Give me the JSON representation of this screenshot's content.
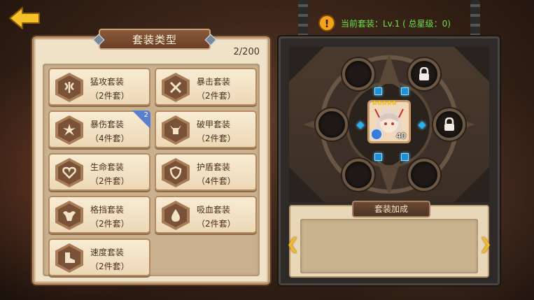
{
  "panel": {
    "title": "套装类型",
    "count": "2/200"
  },
  "sets": [
    {
      "name": "猛攻套装",
      "pieces": "（2件套）",
      "icon": "axe-icon"
    },
    {
      "name": "暴击套装",
      "pieces": "（2件套）",
      "icon": "crossed-swords-icon"
    },
    {
      "name": "暴伤套装",
      "pieces": "（4件套）",
      "icon": "burst-icon",
      "badge": "2"
    },
    {
      "name": "破甲套装",
      "pieces": "（2件套）",
      "icon": "horned-helmet-icon"
    },
    {
      "name": "生命套装",
      "pieces": "（2件套）",
      "icon": "heart-icon"
    },
    {
      "name": "护盾套装",
      "pieces": "（4件套）",
      "icon": "shield-icon"
    },
    {
      "name": "格挡套装",
      "pieces": "（2件套）",
      "icon": "muscle-icon"
    },
    {
      "name": "吸血套装",
      "pieces": "（2件套）",
      "icon": "blood-drop-icon"
    },
    {
      "name": "速度套装",
      "pieces": "（2件套）",
      "icon": "boot-icon"
    }
  ],
  "status": {
    "text": "当前套装：Lv.1 ( 总星级：0)"
  },
  "hero": {
    "level": "40",
    "stars": "★★★★★"
  },
  "bonus": {
    "title": "套装加成"
  },
  "colors": {
    "accent": "#f4b82a",
    "status_green": "#6fe04a",
    "gem_blue": "#2ab0f0"
  }
}
